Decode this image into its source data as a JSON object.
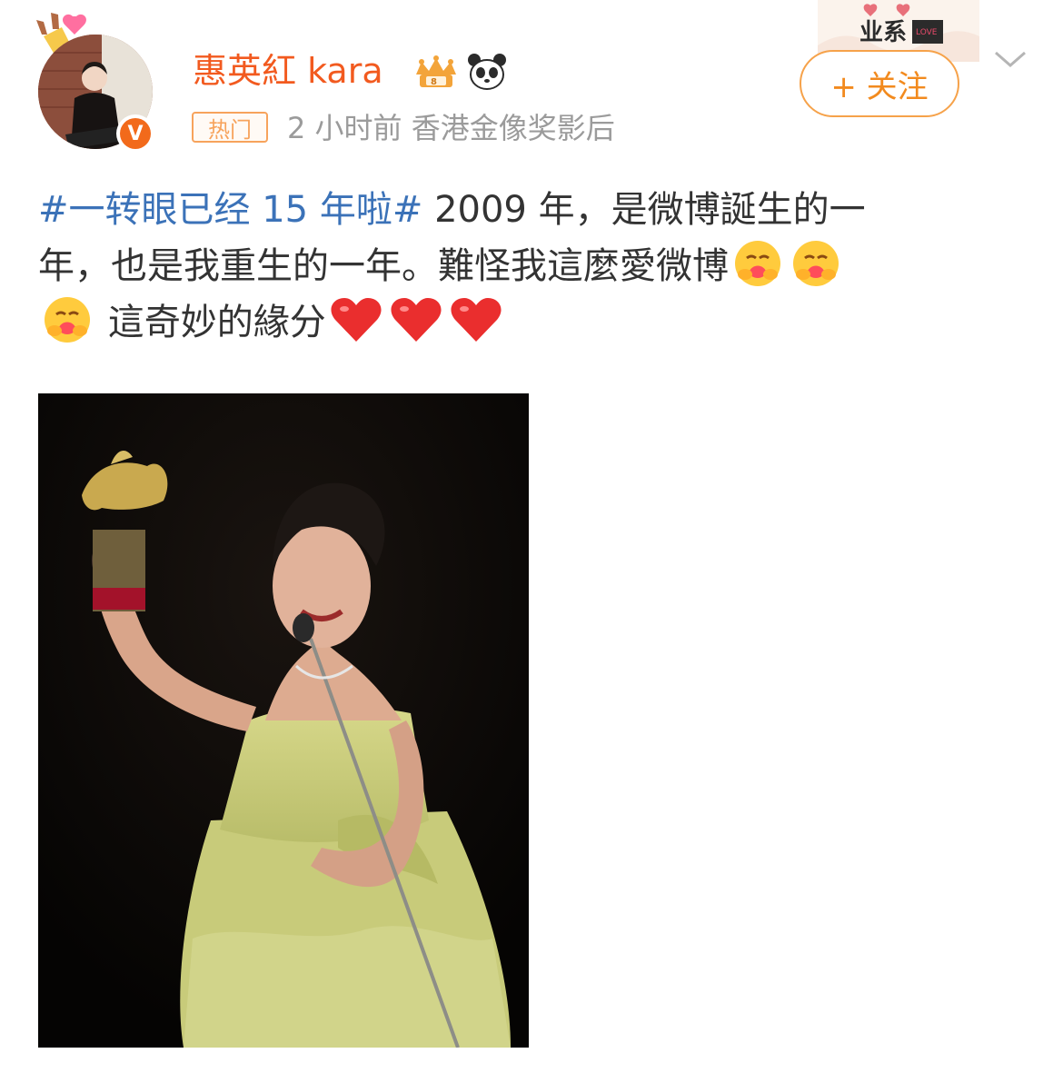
{
  "post": {
    "author": {
      "name": "惠英紅 kara",
      "badges": [
        "crown-icon",
        "panda-icon"
      ],
      "verified_label": "V"
    },
    "meta": {
      "hot_label": "热门",
      "time": "2 小时前",
      "description": "香港金像奖影后"
    },
    "follow_label": "+ 关注",
    "content": {
      "hashtag": "#一转眼已经 15 年啦#",
      "line1": " 2009 年，是微博誕生的一",
      "line2": "年，也是我重生的一年。難怪我這麼愛微博",
      "line3": " 這奇妙的緣分"
    }
  },
  "colors": {
    "accent_orange": "#f25a1f",
    "follow_orange": "#f28a1e",
    "hashtag_blue": "#3b72b8",
    "meta_gray": "#9b9b9b"
  }
}
